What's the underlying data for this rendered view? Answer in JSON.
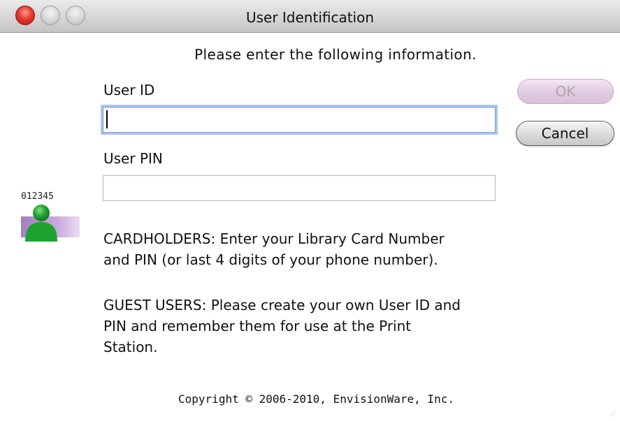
{
  "window": {
    "title": "User Identification"
  },
  "form": {
    "instructions": "Please enter the following information.",
    "user_id_label": "User ID",
    "user_id_value": "",
    "user_pin_label": "User PIN",
    "user_pin_value": ""
  },
  "buttons": {
    "ok_label": "OK",
    "cancel_label": "Cancel"
  },
  "icon": {
    "name": "user-card-icon",
    "card_number": "012345"
  },
  "notes": {
    "cardholders_line1": "CARDHOLDERS: Enter your Library Card Number",
    "cardholders_line2": "and PIN (or last 4 digits of your phone number).",
    "guest_line1": "GUEST USERS: Please create your own User ID and",
    "guest_line2": "PIN and remember them for use at the Print",
    "guest_line3": "Station."
  },
  "footer": {
    "copyright": "Copyright © 2006-2010,  EnvisionWare, Inc."
  },
  "colors": {
    "close_button": "#e8392e",
    "focus_ring": "#a9c6ee",
    "ok_button_tint": "#e3cde3",
    "avatar_green": "#1fa32f",
    "card_purple": "#b18bcf"
  }
}
